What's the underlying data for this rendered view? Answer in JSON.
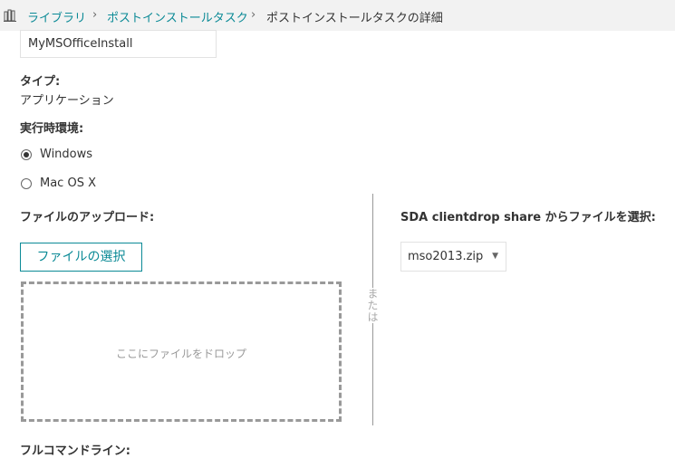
{
  "breadcrumb": {
    "library": "ライブラリ",
    "tasks": "ポストインストールタスク",
    "current": "ポストインストールタスクの詳細",
    "separator": "›"
  },
  "name_field": {
    "value": "MyMSOfficeInstall"
  },
  "type": {
    "label": "タイプ:",
    "value": "アプリケーション"
  },
  "runtime": {
    "label": "実行時環境:",
    "options": [
      {
        "label": "Windows",
        "checked": true
      },
      {
        "label": "Mac OS X",
        "checked": false
      }
    ]
  },
  "upload": {
    "label": "ファイルのアップロード:",
    "button": "ファイルの選択",
    "drop_text": "ここにファイルをドロップ"
  },
  "or_text": "または",
  "share": {
    "label": "SDA clientdrop share からファイルを選択:",
    "selected": "mso2013.zip",
    "caret": "▼"
  },
  "cut_label": "フルコマンドライン:",
  "colors": {
    "accent": "#0b8a96",
    "divider": "#999999"
  },
  "icons": {
    "breadcrumb": "library-icon"
  }
}
